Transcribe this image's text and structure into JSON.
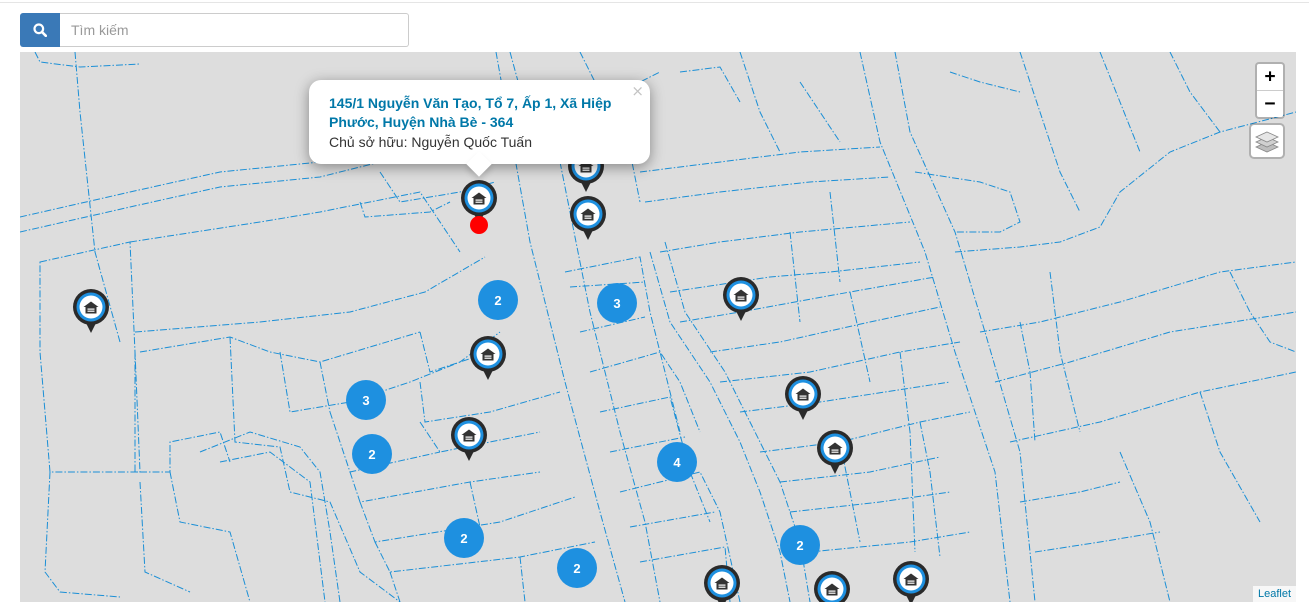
{
  "search": {
    "placeholder": "Tìm kiếm",
    "value": ""
  },
  "map": {
    "zoom_in_label": "+",
    "zoom_out_label": "−",
    "attribution": "Leaflet",
    "parcel_line_color": "#1b8fd6",
    "cluster_color": "#1e90e0",
    "clusters": [
      "2",
      "3",
      "3",
      "2",
      "4",
      "2",
      "2",
      "2"
    ],
    "popup": {
      "title": "145/1 Nguyễn Văn Tạo, Tổ 7, Ấp 1, Xã Hiệp Phước, Huyện Nhà Bè - 364",
      "owner": "Chủ sở hữu: Nguyễn Quốc Tuấn",
      "close_label": "×"
    },
    "marker_icon": "house-icon"
  }
}
